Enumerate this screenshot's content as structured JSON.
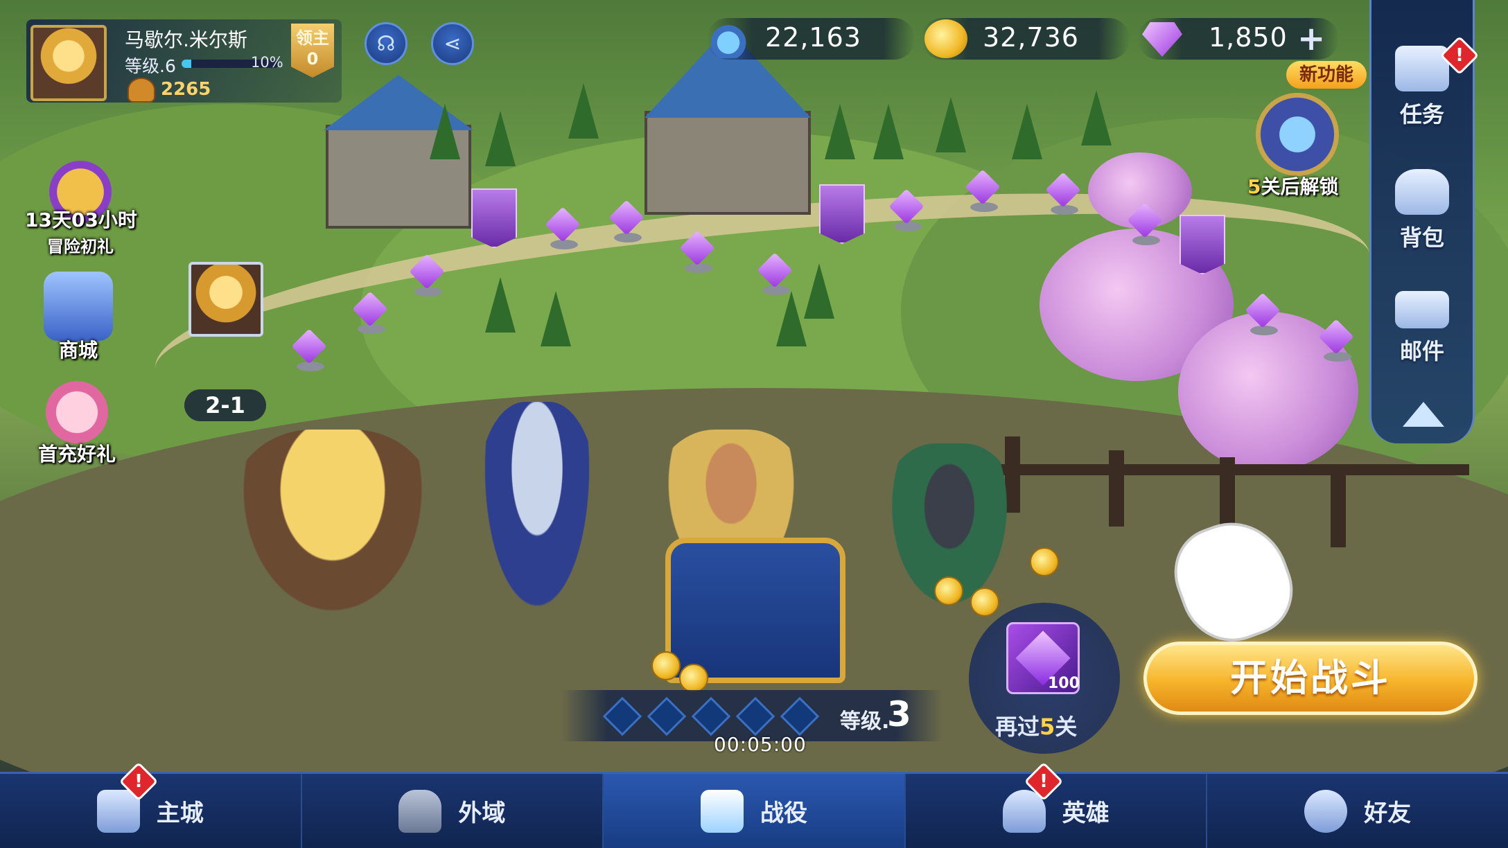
{
  "player": {
    "name": "马歇尔.米尔斯",
    "level_label": "等级.6",
    "xp_fraction": 0.1,
    "xp_percent_label": "10%",
    "power": "2265",
    "lord_badge": {
      "title": "领主",
      "value": "0"
    }
  },
  "header_buttons": {
    "support_icon": "headset-icon",
    "share_icon": "share-icon"
  },
  "currencies": [
    {
      "name": "potion",
      "icon": "potion-icon",
      "value": "22,163"
    },
    {
      "name": "gold",
      "icon": "gold-coin-icon",
      "value": "32,736"
    },
    {
      "name": "gems",
      "icon": "diamond-icon",
      "value": "1,850"
    }
  ],
  "currency_plus": "+",
  "left_events": [
    {
      "icon": "treasure-bag-icon",
      "timer": "13天03小时",
      "label": "冒险初礼"
    },
    {
      "icon": "shop-icon",
      "label": "商城"
    },
    {
      "icon": "first-charge-icon",
      "label": "首充好礼"
    }
  ],
  "right_menu": [
    {
      "label": "任务",
      "icon": "quest-icon",
      "alert": "!"
    },
    {
      "label": "背包",
      "icon": "backpack-icon"
    },
    {
      "label": "邮件",
      "icon": "mail-icon"
    }
  ],
  "new_feature": {
    "badge": "新功能",
    "unlock_num": "5",
    "unlock_text": "关后解锁"
  },
  "map": {
    "current_stage": "2-1"
  },
  "battle": {
    "level_label": "等级.",
    "level_value": "3",
    "timer": "00:05:00",
    "progress_steps_total": 5,
    "reward_count": "100",
    "reward_text_prefix": "再过",
    "reward_text_num": "5",
    "reward_text_suffix": "关",
    "start_button": "开始战斗"
  },
  "bottom_nav": [
    {
      "label": "主城",
      "icon": "castle-icon",
      "alert": "!"
    },
    {
      "label": "外域",
      "icon": "lock-icon"
    },
    {
      "label": "战役",
      "icon": "sword-icon",
      "active": true
    },
    {
      "label": "英雄",
      "icon": "helmet-icon",
      "alert": "!"
    },
    {
      "label": "好友",
      "icon": "friends-icon"
    }
  ],
  "colors": {
    "accent_gold": "#f6b42a",
    "panel_blue": "#1a3570",
    "alert_red": "#e0262d",
    "gem_purple": "#9c38e0"
  }
}
